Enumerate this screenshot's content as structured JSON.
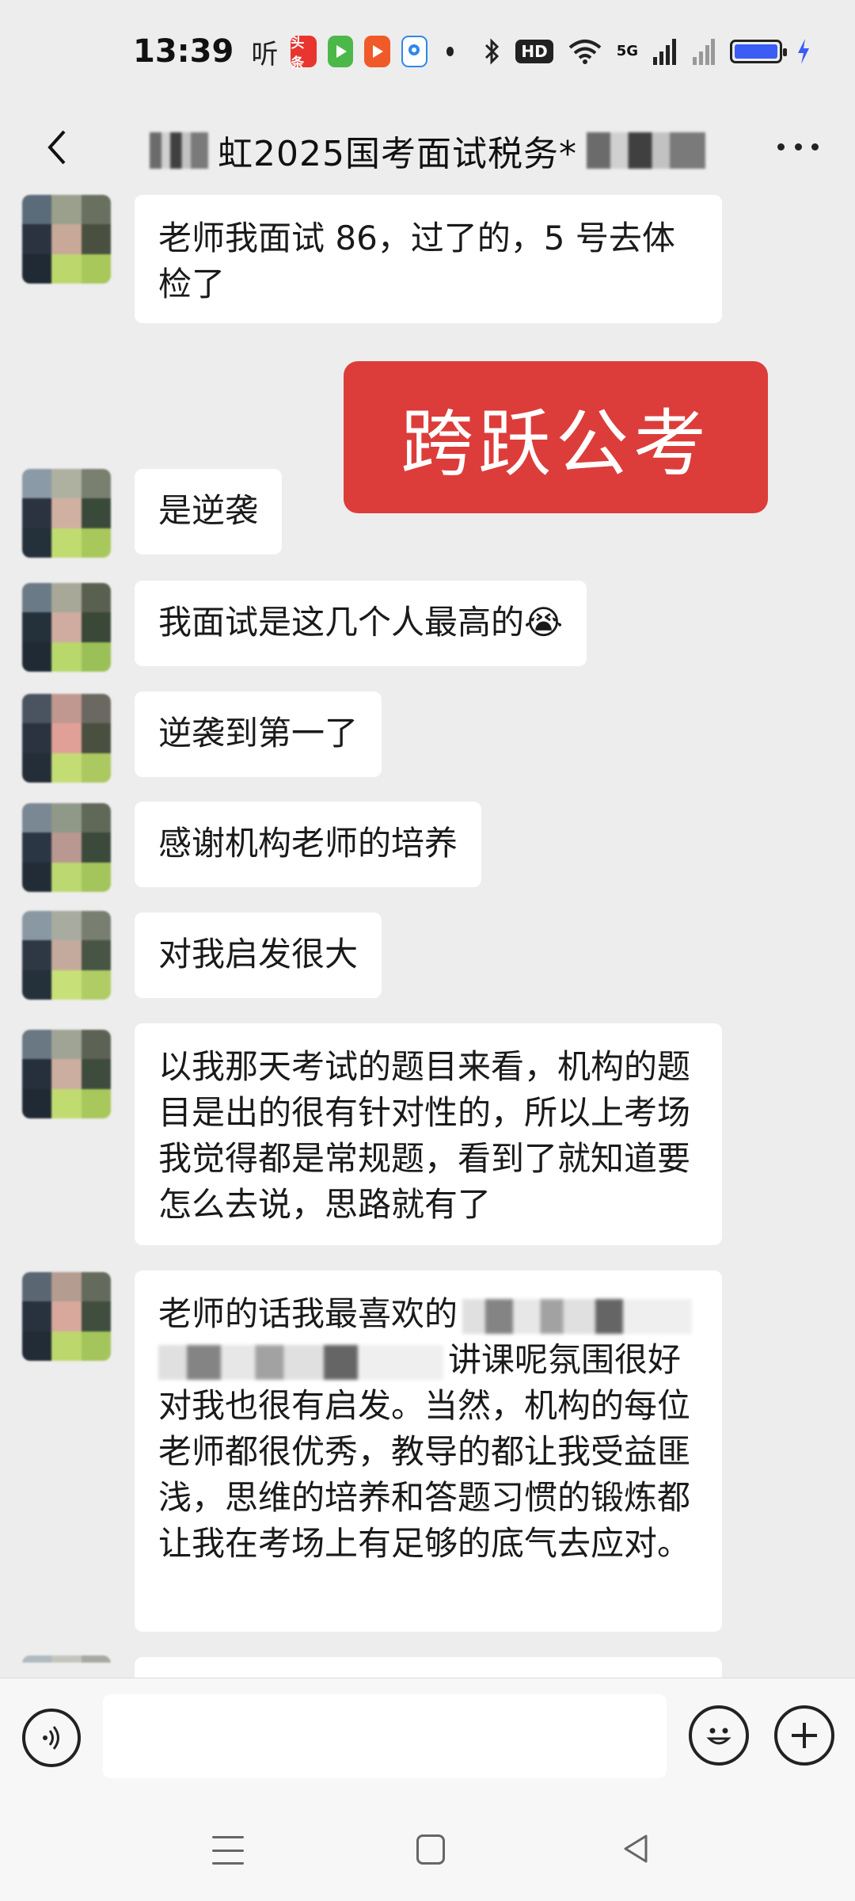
{
  "status_bar": {
    "time": "13:39",
    "ting_label": "听",
    "app_icons": [
      {
        "name": "toutiao-icon",
        "label": "头条",
        "color": "#e8352f"
      },
      {
        "name": "game-app-icon",
        "label": "",
        "color": "#4cb84a"
      },
      {
        "name": "video-app-icon",
        "label": "",
        "color": "#f05a28"
      },
      {
        "name": "location-app-icon",
        "label": "",
        "color": "#2f88e8"
      }
    ],
    "hd_label": "HD",
    "network": "5G",
    "battery_color": "#3b5cf5"
  },
  "header": {
    "title": "虹2025国考面试税务*",
    "back_icon": "chevron-left-icon",
    "more_icon": "more-dots-icon"
  },
  "banner": {
    "text": "跨跃公考",
    "color": "#dc3d3a"
  },
  "messages": [
    {
      "text": "老师我面试 86，过了的，5 号去体检了"
    },
    {
      "text": "是逆袭"
    },
    {
      "text": "我面试是这几个人最高的😭"
    },
    {
      "text": "逆袭到第一了"
    },
    {
      "text": "感谢机构老师的培养"
    },
    {
      "text": "对我启发很大"
    },
    {
      "text": "以我那天考试的题目来看，机构的题目是出的很有针对性的，所以上考场我觉得都是常规题，看到了就知道要怎么去说，思路就有了"
    },
    {
      "text_line1": "老师的话我最喜欢的",
      "text_line2": "讲课呢氛围很好",
      "text_rest": "对我也很有启发。当然，机构的每位老师都很优秀，教导的都让我受益匪浅，思维的培养和答题习惯的锻炼都让我在考场上有足够的底气去应对。"
    }
  ],
  "input_bar": {
    "placeholder": "",
    "voice_icon": "voice-icon",
    "emoji_icon": "emoji-icon",
    "plus_icon": "plus-icon"
  },
  "nav_bar": {
    "menu_icon": "menu-icon",
    "home_icon": "home-icon",
    "back_icon": "back-triangle-icon"
  }
}
